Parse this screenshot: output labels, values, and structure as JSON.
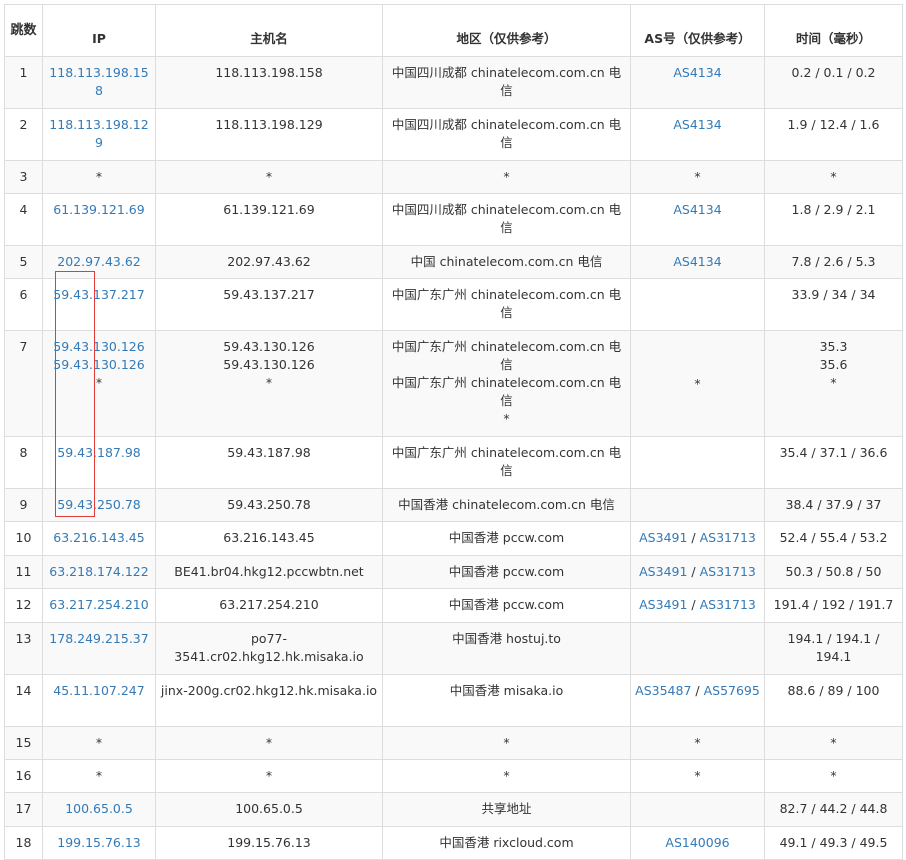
{
  "headers": {
    "hop": "跳数",
    "ip": "IP",
    "host": "主机名",
    "region": "地区（仅供参考）",
    "as": "AS号（仅供参考）",
    "time": "时间（毫秒）"
  },
  "rows": [
    {
      "hop": "1",
      "ips": [
        "118.113.198.158"
      ],
      "hosts": [
        "118.113.198.158"
      ],
      "regions": [
        "中国四川成都 chinatelecom.com.cn 电信"
      ],
      "as": [
        "AS4134"
      ],
      "times": [
        "0.2 / 0.1 / 0.2"
      ]
    },
    {
      "hop": "2",
      "ips": [
        "118.113.198.129"
      ],
      "hosts": [
        "118.113.198.129"
      ],
      "regions": [
        "中国四川成都 chinatelecom.com.cn 电信"
      ],
      "as": [
        "AS4134"
      ],
      "times": [
        "1.9 / 12.4 / 1.6"
      ]
    },
    {
      "hop": "3",
      "ips": [
        "*"
      ],
      "hosts": [
        "*"
      ],
      "regions": [
        "*"
      ],
      "as": [
        "*"
      ],
      "times": [
        "*"
      ]
    },
    {
      "hop": "4",
      "ips": [
        "61.139.121.69"
      ],
      "hosts": [
        "61.139.121.69"
      ],
      "regions": [
        "中国四川成都 chinatelecom.com.cn 电信"
      ],
      "as": [
        "AS4134"
      ],
      "times": [
        "1.8 / 2.9 / 2.1"
      ]
    },
    {
      "hop": "5",
      "ips": [
        "202.97.43.62"
      ],
      "hosts": [
        "202.97.43.62"
      ],
      "regions": [
        "中国 chinatelecom.com.cn 电信"
      ],
      "as": [
        "AS4134"
      ],
      "times": [
        "7.8 / 2.6 / 5.3"
      ]
    },
    {
      "hop": "6",
      "ips": [
        "59.43.137.217"
      ],
      "hosts": [
        "59.43.137.217"
      ],
      "regions": [
        "中国广东广州 chinatelecom.com.cn 电信"
      ],
      "as": [],
      "times": [
        "33.9 / 34 / 34"
      ]
    },
    {
      "hop": "7",
      "ips": [
        "59.43.130.126",
        "59.43.130.126",
        "*"
      ],
      "hosts": [
        "59.43.130.126",
        "59.43.130.126",
        "*"
      ],
      "regions": [
        "中国广东广州 chinatelecom.com.cn 电信",
        "中国广东广州 chinatelecom.com.cn 电信",
        "*"
      ],
      "as": [
        "*"
      ],
      "times": [
        "35.3",
        "35.6",
        "*"
      ]
    },
    {
      "hop": "8",
      "ips": [
        "59.43.187.98"
      ],
      "hosts": [
        "59.43.187.98"
      ],
      "regions": [
        "中国广东广州 chinatelecom.com.cn 电信"
      ],
      "as": [],
      "times": [
        "35.4 / 37.1 / 36.6"
      ]
    },
    {
      "hop": "9",
      "ips": [
        "59.43.250.78"
      ],
      "hosts": [
        "59.43.250.78"
      ],
      "regions": [
        "中国香港 chinatelecom.com.cn 电信"
      ],
      "as": [],
      "times": [
        "38.4 / 37.9 / 37"
      ]
    },
    {
      "hop": "10",
      "ips": [
        "63.216.143.45"
      ],
      "hosts": [
        "63.216.143.45"
      ],
      "regions": [
        "中国香港 pccw.com"
      ],
      "as": [
        "AS3491",
        "AS31713"
      ],
      "times": [
        "52.4 / 55.4 / 53.2"
      ]
    },
    {
      "hop": "11",
      "ips": [
        "63.218.174.122"
      ],
      "hosts": [
        "BE41.br04.hkg12.pccwbtn.net"
      ],
      "regions": [
        "中国香港 pccw.com"
      ],
      "as": [
        "AS3491",
        "AS31713"
      ],
      "times": [
        "50.3 / 50.8 / 50"
      ]
    },
    {
      "hop": "12",
      "ips": [
        "63.217.254.210"
      ],
      "hosts": [
        "63.217.254.210"
      ],
      "regions": [
        "中国香港 pccw.com"
      ],
      "as": [
        "AS3491",
        "AS31713"
      ],
      "times": [
        "191.4 / 192 / 191.7"
      ]
    },
    {
      "hop": "13",
      "ips": [
        "178.249.215.37"
      ],
      "hosts": [
        "po77-3541.cr02.hkg12.hk.misaka.io"
      ],
      "regions": [
        "中国香港 hostuj.to"
      ],
      "as": [],
      "times": [
        "194.1 / 194.1 / 194.1"
      ]
    },
    {
      "hop": "14",
      "ips": [
        "45.11.107.247"
      ],
      "hosts": [
        "jinx-200g.cr02.hkg12.hk.misaka.io"
      ],
      "regions": [
        "中国香港 misaka.io"
      ],
      "as": [
        "AS35487",
        "AS57695"
      ],
      "times": [
        "88.6 / 89 / 100"
      ]
    },
    {
      "hop": "15",
      "ips": [
        "*"
      ],
      "hosts": [
        "*"
      ],
      "regions": [
        "*"
      ],
      "as": [
        "*"
      ],
      "times": [
        "*"
      ]
    },
    {
      "hop": "16",
      "ips": [
        "*"
      ],
      "hosts": [
        "*"
      ],
      "regions": [
        "*"
      ],
      "as": [
        "*"
      ],
      "times": [
        "*"
      ]
    },
    {
      "hop": "17",
      "ips": [
        "100.65.0.5"
      ],
      "hosts": [
        "100.65.0.5"
      ],
      "regions": [
        "共享地址"
      ],
      "as": [],
      "times": [
        "82.7 / 44.2 / 44.8"
      ]
    },
    {
      "hop": "18",
      "ips": [
        "199.15.76.13"
      ],
      "hosts": [
        "199.15.76.13"
      ],
      "regions": [
        "中国香港 rixcloud.com"
      ],
      "as": [
        "AS140096"
      ],
      "times": [
        "49.1 / 49.3 / 49.5"
      ]
    }
  ],
  "colors": {
    "link": "#337ab7",
    "text": "#333333",
    "border": "#dddddd",
    "stripe": "#f9f9f9",
    "highlight": "#e23b3b"
  }
}
